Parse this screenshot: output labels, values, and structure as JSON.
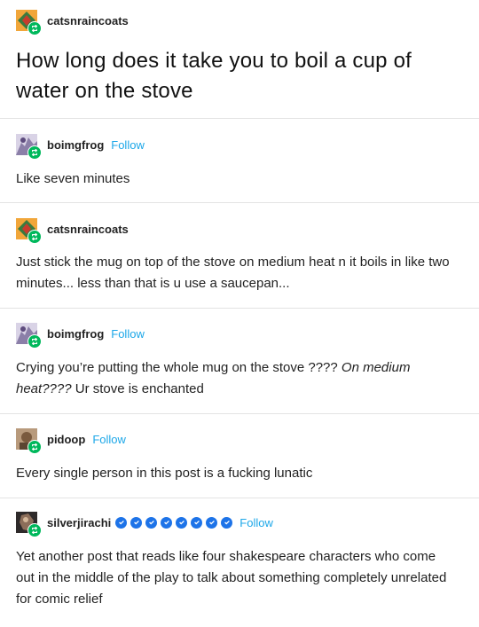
{
  "op": {
    "username": "catsnraincoats",
    "title": "How long does it take you to boil a cup of water on the stove"
  },
  "follow_label": "Follow",
  "replies": [
    {
      "username": "boimgfrog",
      "text": "Like seven minutes"
    },
    {
      "username": "catsnraincoats",
      "text": "Just stick the mug on top of the stove on medium heat n it boils in like two minutes... less than that is u use a saucepan..."
    },
    {
      "username": "boimgfrog",
      "text_plain": "Crying you’re putting the whole mug on the stove ???? ",
      "text_italic": "On medium heat????",
      "text_end": " Ur stove is enchanted"
    },
    {
      "username": "pidoop",
      "text": "Every single person in this post is a fucking lunatic"
    },
    {
      "username": "silverjirachi",
      "verified_badge_count": 8,
      "text": "Yet another post that reads like four shakespeare characters who come out in the middle of the play to talk about something completely unrelated for comic relief"
    }
  ],
  "colors": {
    "follow": "#1ca7e8",
    "reblog_badge": "#00b85c",
    "verified_badge": "#1d73e8",
    "divider": "#e3e3e3"
  },
  "icons": [
    "reblog-icon",
    "verified-badge-icon"
  ]
}
